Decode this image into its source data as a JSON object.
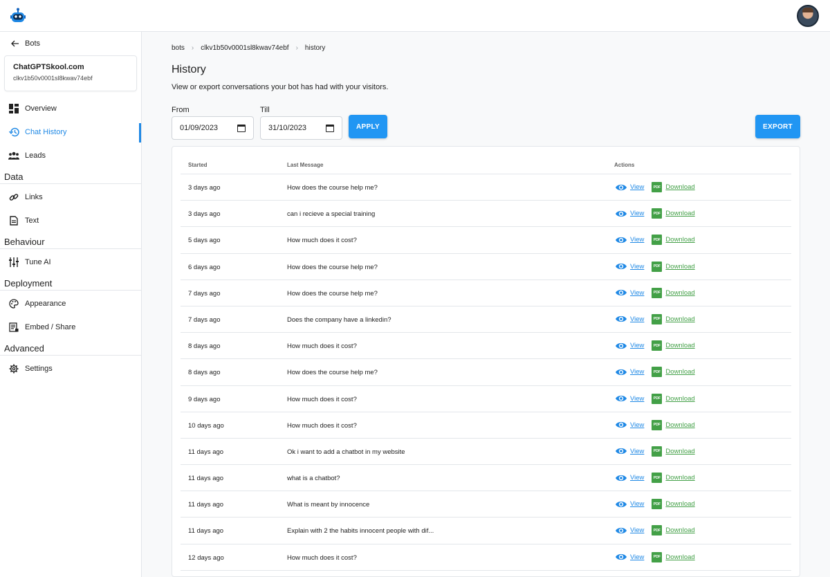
{
  "sidebar": {
    "back_label": "Bots",
    "bot_name": "ChatGPTSkool.com",
    "bot_id": "clkv1b50v0001sl8kwav74ebf",
    "items_top": [
      {
        "label": "Overview",
        "icon": "dashboard-icon"
      },
      {
        "label": "Chat History",
        "icon": "history-icon",
        "active": true
      },
      {
        "label": "Leads",
        "icon": "people-icon"
      }
    ],
    "sections": [
      {
        "title": "Data",
        "items": [
          {
            "label": "Links",
            "icon": "link-icon"
          },
          {
            "label": "Text",
            "icon": "document-icon"
          }
        ]
      },
      {
        "title": "Behaviour",
        "items": [
          {
            "label": "Tune AI",
            "icon": "tune-icon"
          }
        ]
      },
      {
        "title": "Deployment",
        "items": [
          {
            "label": "Appearance",
            "icon": "palette-icon"
          },
          {
            "label": "Embed / Share",
            "icon": "embed-icon"
          }
        ]
      },
      {
        "title": "Advanced",
        "items": [
          {
            "label": "Settings",
            "icon": "gear-icon"
          }
        ]
      }
    ]
  },
  "breadcrumb": [
    "bots",
    "clkv1b50v0001sl8kwav74ebf",
    "history"
  ],
  "page": {
    "title": "History",
    "subtitle": "View or export conversations your bot has had with your visitors."
  },
  "filters": {
    "from_label": "From",
    "from_value": "01/09/2023",
    "till_label": "Till",
    "till_value": "31/10/2023",
    "apply_label": "APPLY",
    "export_label": "EXPORT"
  },
  "table": {
    "headers": {
      "started": "Started",
      "message": "Last Message",
      "actions": "Actions"
    },
    "view_label": "View",
    "download_label": "Download",
    "pdf_label": "PDF",
    "rows": [
      {
        "started": "3 days ago",
        "message": "How does the course help me?"
      },
      {
        "started": "3 days ago",
        "message": "can i recieve a special training"
      },
      {
        "started": "5 days ago",
        "message": "How much does it cost?"
      },
      {
        "started": "6 days ago",
        "message": "How does the course help me?"
      },
      {
        "started": "7 days ago",
        "message": "How does the course help me?"
      },
      {
        "started": "7 days ago",
        "message": "Does the company have a linkedin?"
      },
      {
        "started": "8 days ago",
        "message": "How much does it cost?"
      },
      {
        "started": "8 days ago",
        "message": "How does the course help me?"
      },
      {
        "started": "9 days ago",
        "message": "How much does it cost?"
      },
      {
        "started": "10 days ago",
        "message": "How much does it cost?"
      },
      {
        "started": "11 days ago",
        "message": "Ok i want to add a chatbot in my website"
      },
      {
        "started": "11 days ago",
        "message": "what is a chatbot?"
      },
      {
        "started": "11 days ago",
        "message": "What is meant by innocence"
      },
      {
        "started": "11 days ago",
        "message": "Explain with 2 the habits innocent people with dif..."
      },
      {
        "started": "12 days ago",
        "message": "How much does it cost?"
      }
    ]
  },
  "colors": {
    "accent": "#1e88e5",
    "button": "#2196f3",
    "download": "#43a047"
  }
}
